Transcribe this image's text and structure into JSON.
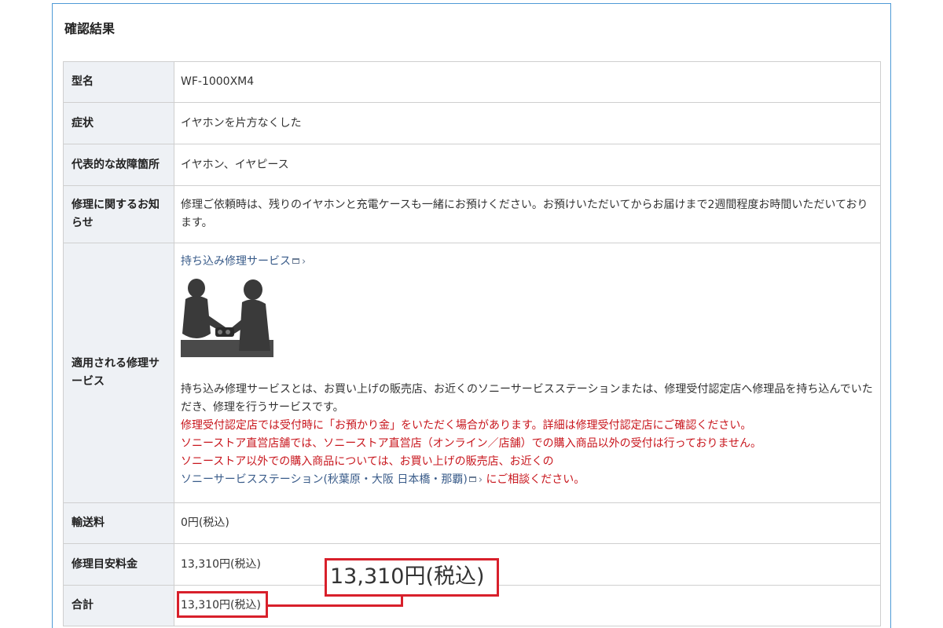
{
  "panel": {
    "title": "確認結果"
  },
  "rows": {
    "model": {
      "label": "型名",
      "value": "WF-1000XM4"
    },
    "symptom": {
      "label": "症状",
      "value": "イヤホンを片方なくした"
    },
    "part": {
      "label": "代表的な故障箇所",
      "value": "イヤホン、イヤピース"
    },
    "notice": {
      "label": "修理に関するお知らせ",
      "value": "修理ご依頼時は、残りのイヤホンと充電ケースも一緒にお預けください。お預けいただいてからお届けまで2週間程度お時間いただいております。"
    },
    "service": {
      "label": "適用される修理サービス",
      "link": "持ち込み修理サービス",
      "description": "持ち込み修理サービスとは、お買い上げの販売店、お近くのソニーサービスステーションまたは、修理受付認定店へ修理品を持ち込んでいただき、修理を行うサービスです。",
      "note1": "修理受付認定店では受付時に「お預かり金」をいただく場合があります。詳細は修理受付認定店にご確認ください。",
      "note2": "ソニーストア直営店舗では、ソニーストア直営店（オンライン／店舗）での購入商品以外の受付は行っておりません。",
      "note3": "ソニーストア以外での購入商品については、お買い上げの販売店、お近くの",
      "station_link": "ソニーサービスステーション(秋葉原・大阪 日本橋・那覇)",
      "note4": "にご相談ください。"
    },
    "shipping": {
      "label": "輸送料",
      "value": "0円(税込)"
    },
    "estimate": {
      "label": "修理目安料金",
      "value": "13,310円(税込)"
    },
    "total": {
      "label": "合計",
      "value": "13,310円(税込)"
    }
  },
  "callout": {
    "text": "13,310円(税込)"
  },
  "icons": {
    "external": "external-window-icon",
    "chevron": "chevron-right-icon"
  },
  "colors": {
    "accent_red": "#c8161d",
    "link": "#3a5c8a",
    "label_bg": "#eef1f5",
    "panel_border": "#4f9ad6"
  }
}
